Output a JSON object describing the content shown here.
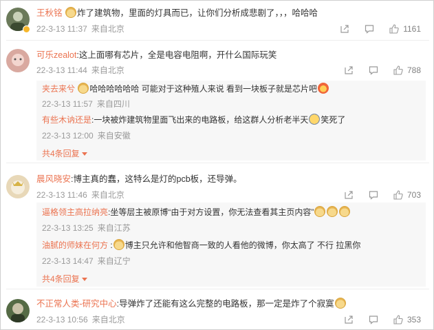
{
  "comments": [
    {
      "name": "王秋铭",
      "text_before": "炸了建筑物，里面的灯具而已，让你们分析成悲剧了，，，哈哈哈",
      "date": "22-3-13 11:37",
      "source": "来自北京",
      "likes": "1161",
      "avatar_color": "#6b7a5a"
    },
    {
      "name": "可乐zealot",
      "text": ":这上面哪有芯片，全是电容电阻啊，开什么国际玩笑",
      "date": "22-3-13 11:44",
      "source": "来自北京",
      "likes": "788",
      "avatar_color": "#d9a9a0",
      "replies": [
        {
          "name": "夹去来兮",
          "text": "哈哈哈哈哈哈 可能对于这种殖人来说 看到一块板子就是芯片吧",
          "date": "22-3-13 11:57",
          "source": "来自四川"
        },
        {
          "name": "有些木讷还是",
          "text": ":一块被炸建筑物里面飞出来的电路板，给这群人分析老半天",
          "text_after": "笑死了",
          "date": "22-3-13 12:00",
          "source": "来自安徽"
        }
      ],
      "more_label": "共4条回复"
    },
    {
      "name": "晨风晓安",
      "text": ":博主真的蠢，这特么是灯的pcb板，还导弹。",
      "date": "22-3-13 11:46",
      "source": "来自北京",
      "likes": "703",
      "avatar_color": "#e8d8b8",
      "replies": [
        {
          "name": "逼格领主高拉纳亮",
          "text": ":坐等层主被原博“由于对方设置，你无法查看其主页内容”",
          "date": "22-3-13 13:25",
          "source": "来自江苏"
        },
        {
          "name": "油腻的师妹在何方",
          "text": "博主只允许和他智商一致的人看他的微博，你太高了 不行 拉黑你",
          "date": "22-3-13 14:47",
          "source": "来自辽宁"
        }
      ],
      "more_label": "共4条回复"
    },
    {
      "name": "不正常人类-研究中心",
      "text": ":导弹炸了还能有这么完整的电路板，那一定是炸了个寂寞",
      "date": "22-3-13 10:56",
      "source": "来自北京",
      "likes": "353",
      "avatar_color": "#556b45"
    }
  ],
  "icons": {
    "share": "share-icon",
    "comment": "comment-icon",
    "like": "thumbs-up-icon"
  },
  "colors": {
    "name": "#eb7350",
    "meta": "#999999",
    "reply_bg": "#f7f7f7"
  }
}
